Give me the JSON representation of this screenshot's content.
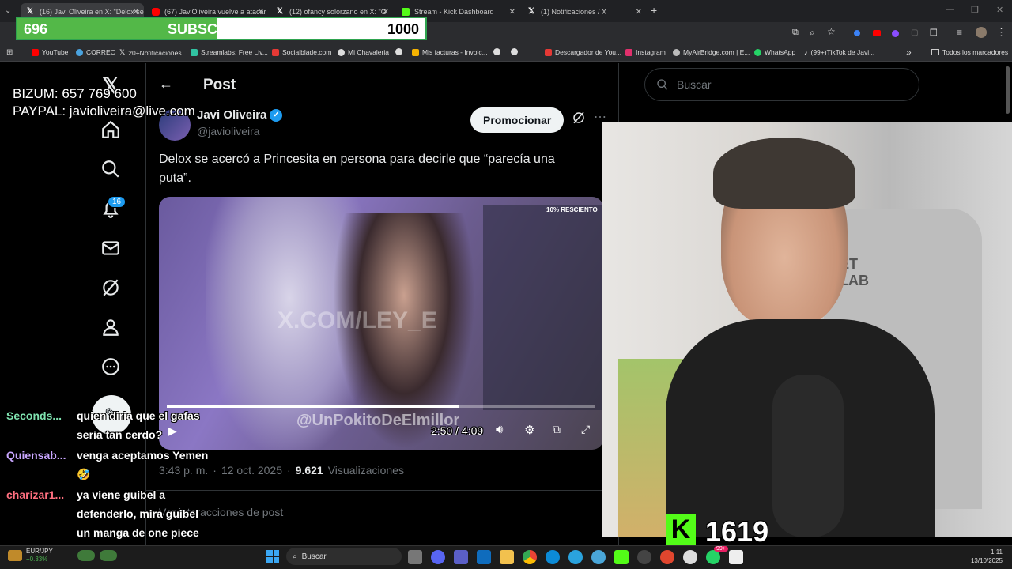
{
  "browser": {
    "tabs": [
      {
        "label": "(16) Javi Oliveira en X: \"Delox se",
        "color": "#ffffff"
      },
      {
        "label": "(67) JaviOliveira vuelve a atacar",
        "color": "#ff0000"
      },
      {
        "label": "(12) ofancy solorzano en X: \"G",
        "color": "#ffffff"
      },
      {
        "label": "Stream - Kick Dashboard",
        "color": "#53fc18"
      },
      {
        "label": "(1) Notificaciones / X",
        "color": "#ffffff"
      }
    ],
    "new_tab": "+",
    "bookmarks": [
      {
        "label": "YouTube",
        "color": "#ff0000"
      },
      {
        "label": "CORREO",
        "color": "#4aa3df"
      },
      {
        "label": "20+Notificaciones",
        "color": "#ffffff"
      },
      {
        "label": "Streamlabs: Free Liv...",
        "color": "#31c3a2"
      },
      {
        "label": "Socialblade.com",
        "color": "#e53935"
      },
      {
        "label": "Mi Chavaleria",
        "color": "#ffffff"
      },
      {
        "label": "",
        "color": "#ffffff"
      },
      {
        "label": "Mis facturas - Invoic...",
        "color": "#f5b301"
      },
      {
        "label": "",
        "color": "#ffffff"
      },
      {
        "label": "",
        "color": "#ffffff"
      },
      {
        "label": "Descargador de You...",
        "color": "#e53935"
      },
      {
        "label": "Instagram",
        "color": "#e1306c"
      },
      {
        "label": "MyAirBridge.com | E...",
        "color": "#bbbbbb"
      },
      {
        "label": "WhatsApp",
        "color": "#25d366"
      },
      {
        "label": "(99+)TikTok de Javi...",
        "color": "#ffffff"
      }
    ],
    "bookmarks_more": "»",
    "all_bookmarks": "Todos los marcadores"
  },
  "overlay": {
    "subs_current": "696",
    "subs_label": "SUBSCRIBERS",
    "subs_goal": "1000",
    "subs_progress": 0.696,
    "bizum": "BIZUM: 657 769 600",
    "paypal": "PAYPAL: javioliveira@live.com",
    "kick_logo": "K",
    "kick_count": "1619"
  },
  "nav": {
    "notifications_badge": "16"
  },
  "post": {
    "header_title": "Post",
    "author_name": "Javi Oliveira",
    "author_handle": "@javioliveira",
    "promote_label": "Promocionar",
    "text": "Delox se acercó a Princesita en persona para decirle que “parecía una puta”.",
    "video_time": "2:50 / 4:09",
    "video_progress": 0.683,
    "video_watermark": "@UnPokitoDeElmillor",
    "video_watermark2": "X.COM/LEY_E",
    "video_badge": "10% RESCIENTO",
    "timestamp": "3:43 p. m.",
    "date": "12 oct. 2025",
    "views_count": "9.621",
    "views_label": "Visualizaciones",
    "interactions": "Ver interacciones de post"
  },
  "search": {
    "placeholder": "Buscar"
  },
  "chat": [
    {
      "user": "Seconds...",
      "color": "#7fe3b0",
      "message": "quien diria que el gafas seria tan cerdo?"
    },
    {
      "user": "Quiensab...",
      "color": "#c9a6ff",
      "message": "venga aceptamos Yemen 🤣"
    },
    {
      "user": "charizar1...",
      "color": "#ff6f7f",
      "message": "ya viene guibel a defenderlo, mira guibel un manga de one piece"
    }
  ],
  "taskbar": {
    "ticker_symbol": "EUR/JPY",
    "ticker_change": "+0.33%",
    "search_label": "Buscar",
    "whatsapp_badge": "99+",
    "time": "1:11",
    "date": "13/10/2025"
  }
}
